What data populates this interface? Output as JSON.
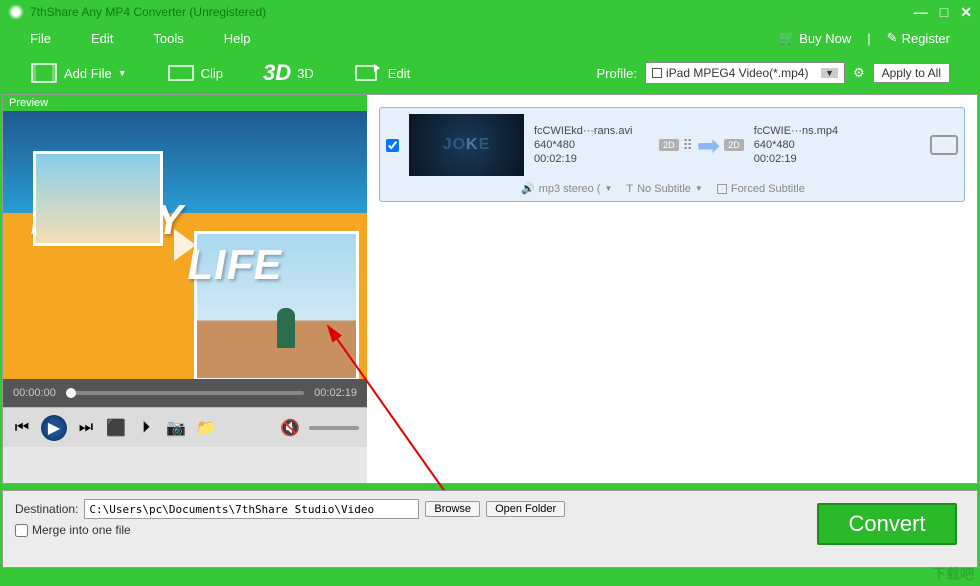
{
  "window": {
    "title": "7thShare Any MP4 Converter (Unregistered)"
  },
  "menu": {
    "file": "File",
    "edit": "Edit",
    "tools": "Tools",
    "help": "Help",
    "buy_now": "Buy Now",
    "register": "Register"
  },
  "toolbar": {
    "add_file": "Add File",
    "clip": "Clip",
    "three_d": "3D",
    "edit": "Edit",
    "profile_label": "Profile:",
    "profile_value": "iPad MPEG4 Video(*.mp4)",
    "apply_all": "Apply to All"
  },
  "preview": {
    "label": "Preview",
    "time_current": "00:00:00",
    "time_total": "00:02:19"
  },
  "file_list": {
    "items": [
      {
        "source_name": "fcCWIEkd···rans.avi",
        "source_res": "640*480",
        "source_dur": "00:02:19",
        "target_name": "fcCWIE···ns.mp4",
        "target_res": "640*480",
        "target_dur": "00:02:19",
        "badge_src": "2D",
        "badge_dst": "2D",
        "audio": "mp3 stereo (",
        "subtitle": "No Subtitle",
        "forced_sub": "Forced Subtitle"
      }
    ]
  },
  "bottom": {
    "dest_label": "Destination:",
    "dest_path": "C:\\Users\\pc\\Documents\\7thShare Studio\\Video",
    "browse": "Browse",
    "open_folder": "Open Folder",
    "merge": "Merge into one file",
    "convert": "Convert"
  },
  "watermark": "下载吧"
}
